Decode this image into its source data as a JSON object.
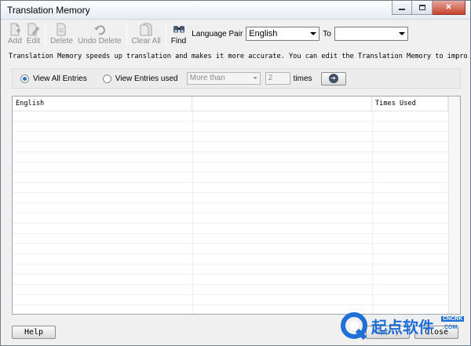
{
  "window": {
    "title": "Translation Memory",
    "controls": [
      "minimize",
      "maximize",
      "close"
    ]
  },
  "toolbar": {
    "buttons": [
      {
        "label": "Add",
        "icon": "add-doc-icon",
        "enabled": false
      },
      {
        "label": "Edit",
        "icon": "edit-doc-icon",
        "enabled": false
      },
      {
        "label": "Delete",
        "icon": "delete-doc-icon",
        "enabled": false
      },
      {
        "label": "Undo Delete",
        "icon": "undo-icon",
        "enabled": false
      },
      {
        "label": "Clear All",
        "icon": "clear-all-icon",
        "enabled": false
      },
      {
        "label": "Find",
        "icon": "binoculars-icon",
        "enabled": true
      }
    ],
    "language_pair_label": "Language Pair",
    "language_from": "English",
    "to_label": "To",
    "language_to": ""
  },
  "description": "Translation Memory speeds up translation and makes it more accurate. You can edit the Translation Memory to improve th...",
  "filter": {
    "view_all_label": "View All Entries",
    "view_used_label": "View Entries used",
    "selected": "view_all",
    "comparison": "More than",
    "count": "2",
    "times_label": "times"
  },
  "table": {
    "columns": [
      "English",
      "",
      "Times Used"
    ],
    "rows": []
  },
  "footer": {
    "help_label": "Help",
    "apply_label": "Apply",
    "close_label": "Close"
  },
  "watermark": {
    "text": "起点软件",
    "badge": "CNCRK",
    "domain": ".COM"
  },
  "colors": {
    "accent": "#2a6fc9",
    "close_button": "#c7432e",
    "watermark_blue": "#1f6fd6"
  }
}
